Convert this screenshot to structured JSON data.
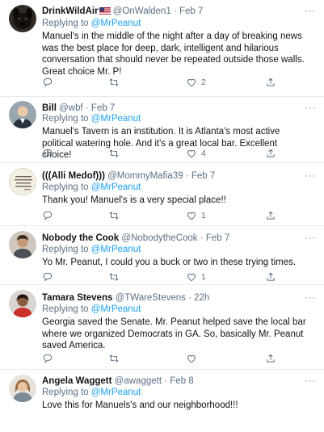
{
  "tweets": [
    {
      "name": "DrinkWildAir",
      "has_flag": true,
      "handle": "@OnWalden1",
      "time": "Feb 7",
      "replying_prefix": "Replying to",
      "replying_to": "@MrPeanut",
      "text": "Manuel's in the middle of the night after a day of breaking news was the best place for deep, dark, intelligent and hilarious conversation that should never be repeated outside those walls. Great choice Mr. P!",
      "likes": "2",
      "retweets": "",
      "avatar_icon": "dog-avatar-icon"
    },
    {
      "name": "Bill",
      "handle": "@wbf",
      "time": "Feb 7",
      "replying_prefix": "Replying to",
      "replying_to": "@MrPeanut",
      "text": "Manuel's Tavern is an institution. It is Atlanta's most active political watering hole. And it's a great local bar. Excellent choice!",
      "likes": "4",
      "retweets": "",
      "avatar_icon": "person-avatar-icon"
    },
    {
      "name": "(((Alli Medof)))",
      "handle": "@MommyMafia39",
      "time": "Feb 7",
      "replying_prefix": "Replying to",
      "replying_to": "@MrPeanut",
      "text": "Thank you! Manuel's is a very special place!!",
      "likes": "1",
      "retweets": "",
      "avatar_icon": "note-avatar-icon"
    },
    {
      "name": "Nobody the Cook",
      "handle": "@NobodytheCook",
      "time": "Feb 7",
      "replying_prefix": "Replying to",
      "replying_to": "@MrPeanut",
      "text": "Yo Mr. Peanut, I could you a buck or two in these trying times.",
      "likes": "1",
      "retweets": "",
      "avatar_icon": "person-avatar-icon"
    },
    {
      "name": "Tamara Stevens",
      "handle": "@TWareStevens",
      "time": "22h",
      "replying_prefix": "Replying to",
      "replying_to": "@MrPeanut",
      "text": "Georgia saved the Senate. Mr. Peanut helped save the local bar where we organized Democrats in GA. So, basically Mr. Peanut saved America.",
      "likes": "",
      "retweets": "",
      "avatar_icon": "person-avatar-icon"
    },
    {
      "name": "Angela Waggett",
      "handle": "@awaggett",
      "time": "Feb 8",
      "replying_prefix": "Replying to",
      "replying_to": "@MrPeanut",
      "text": "Love this for Manuels's and our neighborhood!!!",
      "likes": "",
      "retweets": "",
      "avatar_icon": "person-avatar-icon"
    }
  ],
  "labels": {
    "dot": "·",
    "more": "···"
  },
  "colors": {
    "secondary_text": "#5b7083",
    "link": "#1da1f2",
    "divider": "#e6ecf0"
  }
}
